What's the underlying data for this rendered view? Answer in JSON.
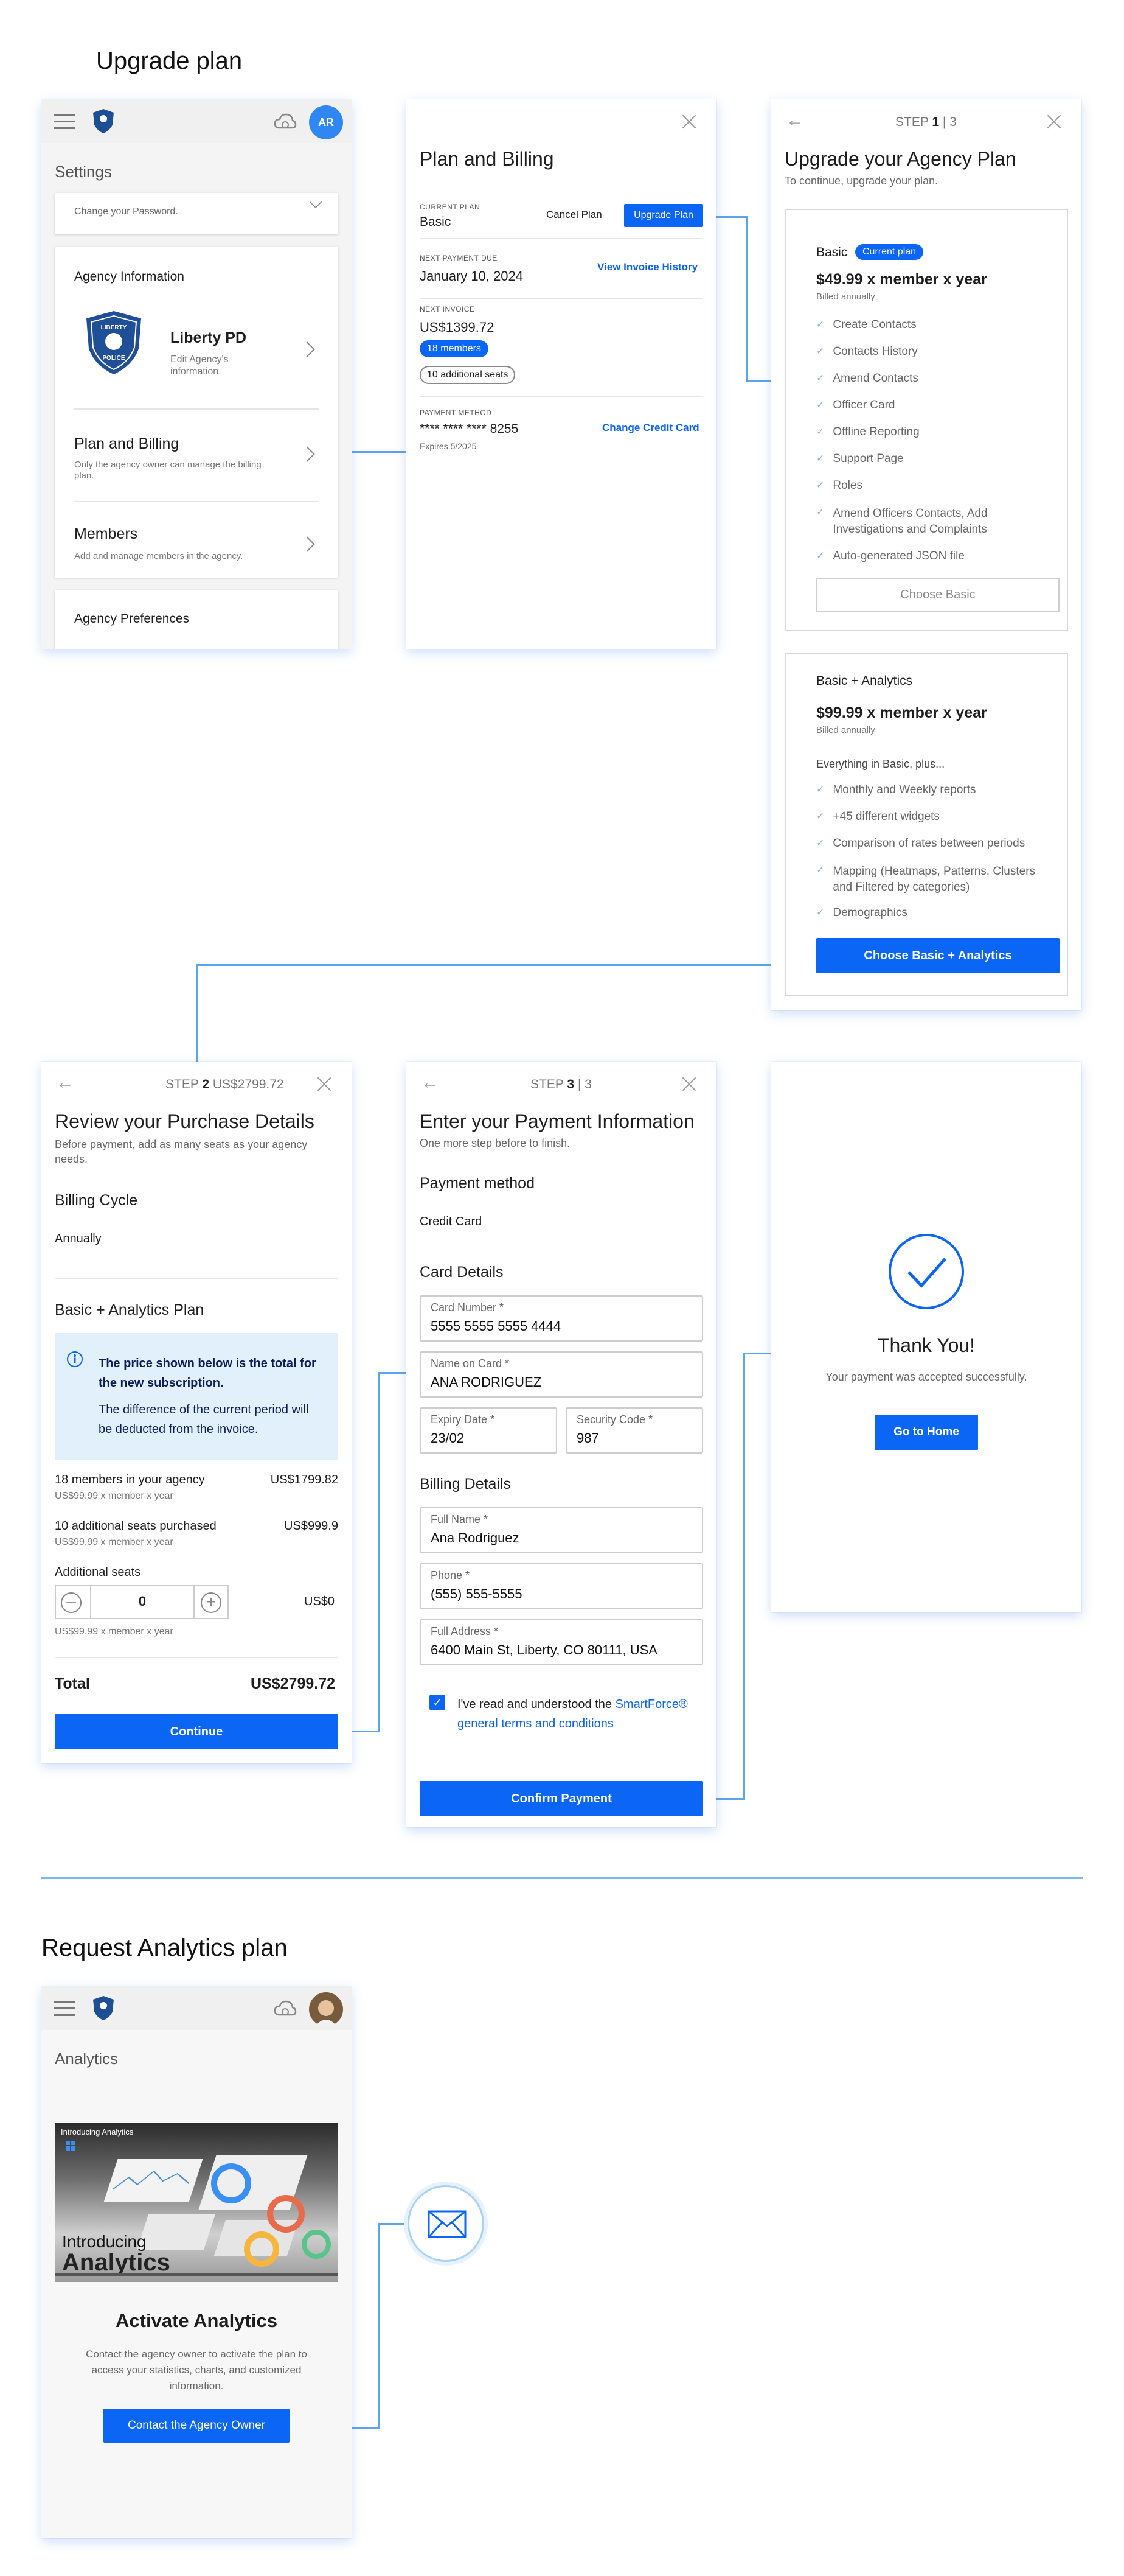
{
  "section1": {
    "title": "Upgrade plan"
  },
  "section2": {
    "title": "Request Analytics plan"
  },
  "settings": {
    "title": "Settings",
    "avatar": "AR",
    "password_sub": "Change your Password.",
    "agency_info_title": "Agency Information",
    "agency_name": "Liberty PD",
    "agency_sub": "Edit Agency's information.",
    "logo_top": "LIBERTY",
    "logo_mid": "POLICE",
    "plan_title": "Plan and Billing",
    "plan_sub": "Only the agency owner can manage the billing plan.",
    "members_title": "Members",
    "members_sub": "Add and manage members in the agency.",
    "prefs_title": "Agency Preferences"
  },
  "billing": {
    "title": "Plan and Billing",
    "current_plan_label": "CURRENT PLAN",
    "current_plan": "Basic",
    "cancel": "Cancel Plan",
    "upgrade": "Upgrade Plan",
    "next_due_label": "NEXT PAYMENT DUE",
    "next_due": "January 10, 2024",
    "view_invoice": "View Invoice History",
    "next_invoice_label": "NEXT INVOICE",
    "next_invoice": "US$1399.72",
    "members_badge": "18 members",
    "seats_badge": "10 additional seats",
    "pm_label": "PAYMENT METHOD",
    "card": "**** **** **** 8255",
    "change_card": "Change Credit Card",
    "expires": "Expires 5/2025"
  },
  "step1": {
    "step": "STEP",
    "num": "1",
    "total": "| 3",
    "title": "Upgrade your Agency Plan",
    "subtitle": "To continue, upgrade your plan.",
    "basic": {
      "name": "Basic",
      "badge": "Current plan",
      "price": "$49.99 x member x year",
      "billed": "Billed annually",
      "features": [
        "Create Contacts",
        "Contacts History",
        "Amend Contacts",
        "Officer Card",
        "Offline Reporting",
        "Support Page",
        "Roles",
        "Amend Officers Contacts, Add Investigations and Complaints",
        "Auto-generated JSON file"
      ],
      "button": "Choose Basic"
    },
    "analytics": {
      "name": "Basic + Analytics",
      "price": "$99.99 x member x year",
      "billed": "Billed annually",
      "intro": "Everything in Basic, plus...",
      "features": [
        "Monthly and Weekly reports",
        "+45 different widgets",
        "Comparison of rates between periods",
        "Mapping (Heatmaps, Patterns, Clusters and Filtered by categories)",
        "Demographics"
      ],
      "button": "Choose Basic + Analytics"
    }
  },
  "step2": {
    "step": "STEP",
    "num": "2",
    "total": "US$2799.72",
    "title": "Review your Purchase Details",
    "subtitle": "Before payment, add as many seats as your agency needs.",
    "cycle_title": "Billing Cycle",
    "cycle": "Annually",
    "plan_title": "Basic + Analytics Plan",
    "info_bold": "The price shown below is the total for the new subscription.",
    "info_text": "The difference of the current period will be deducted from the invoice.",
    "rows": [
      {
        "label": "18 members in your agency",
        "amount": "US$1799.82",
        "sub": "US$99.99 x member x year"
      },
      {
        "label": "10 additional seats purchased",
        "amount": "US$999.9",
        "sub": "US$99.99 x member x year"
      }
    ],
    "add_label": "Additional seats",
    "qty": "0",
    "add_amount": "US$0",
    "add_sub": "US$99.99 x member x year",
    "total_label": "Total",
    "button": "Continue"
  },
  "step3": {
    "step": "STEP",
    "num": "3",
    "total": "| 3",
    "title": "Enter your Payment Information",
    "subtitle": "One more step before to finish.",
    "pm_title": "Payment method",
    "pm": "Credit Card",
    "card_title": "Card Details",
    "card_number_label": "Card Number *",
    "card_number": "5555 5555 5555 4444",
    "name_label": "Name on Card *",
    "name": "ANA RODRIGUEZ",
    "exp_label": "Expiry Date *",
    "exp": "23/02",
    "cvv_label": "Security Code *",
    "cvv": "987",
    "billing_title": "Billing Details",
    "full_name_label": "Full Name *",
    "full_name": "Ana Rodriguez",
    "phone_label": "Phone *",
    "phone": "(555) 555-5555",
    "address_label": "Full Address *",
    "address": "6400 Main St, Liberty, CO 80111, USA",
    "terms_text": "I've read and understood the",
    "terms_link": "SmartForce® general terms and conditions",
    "button": "Confirm Payment"
  },
  "thanks": {
    "title": "Thank You!",
    "sub": "Your payment was accepted successfully.",
    "button": "Go to Home"
  },
  "analytics": {
    "title": "Analytics",
    "video_label": "Introducing Analytics",
    "video_big1": "Introducing",
    "video_big2": "Analytics",
    "heading": "Activate Analytics",
    "text": "Contact the agency owner to activate the plan to access your statistics, charts, and customized information.",
    "button": "Contact the Agency Owner"
  },
  "colors": {
    "accent": "#0b66f6",
    "connector": "#5aa6ec"
  }
}
